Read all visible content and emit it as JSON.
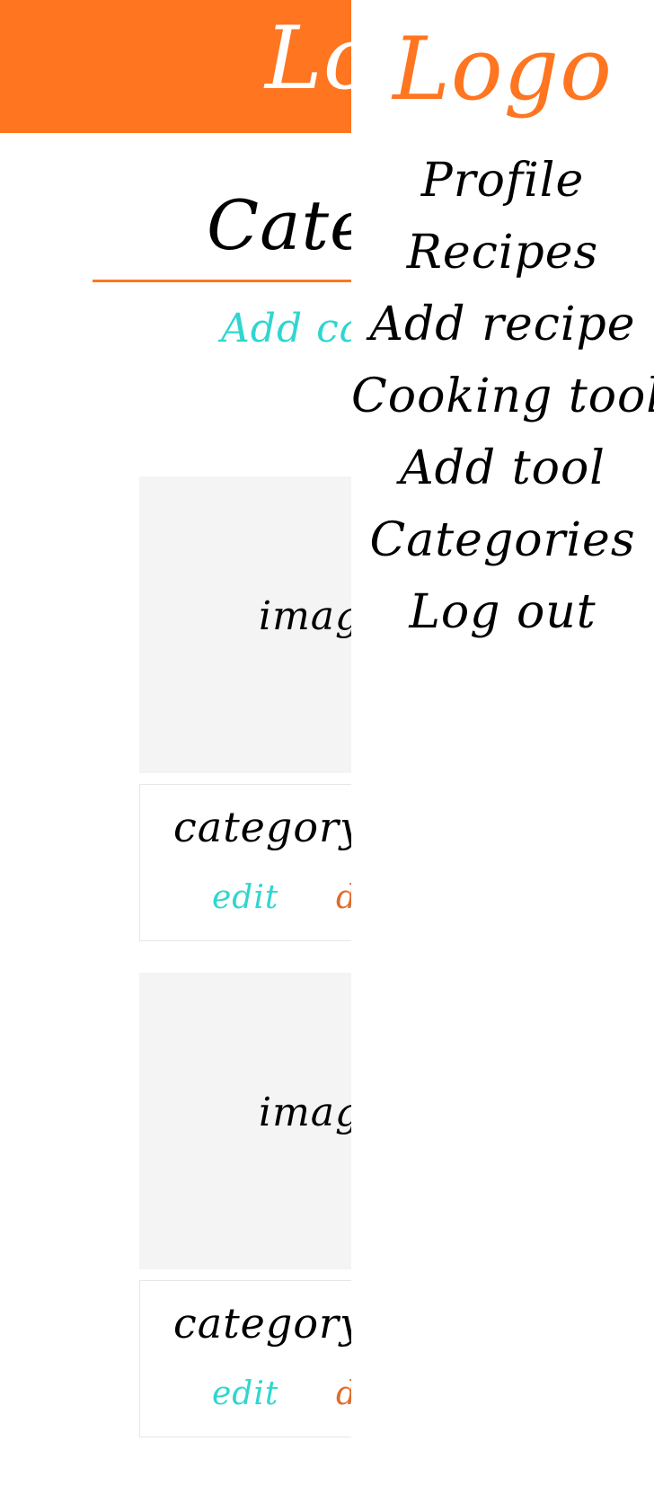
{
  "app": {
    "logo_text": "Logo"
  },
  "main": {
    "title": "Categories",
    "add_link": "Add category",
    "cards": [
      {
        "image_label": "image",
        "name": "category name",
        "edit_label": "edit",
        "delete_label": "delete"
      },
      {
        "image_label": "image",
        "name": "category name",
        "edit_label": "edit",
        "delete_label": "delete"
      }
    ]
  },
  "drawer": {
    "logo_text": "Logo",
    "items": [
      {
        "label": "Profile"
      },
      {
        "label": "Recipes"
      },
      {
        "label": "Add recipe"
      },
      {
        "label": "Cooking tools"
      },
      {
        "label": "Add tool"
      },
      {
        "label": "Categories"
      },
      {
        "label": "Log out"
      }
    ]
  },
  "colors": {
    "brand_orange": "#ff7520",
    "accent_teal": "#2fd6d1",
    "delete_orange": "#e06b2a",
    "image_placeholder": "#f4f4f4"
  }
}
